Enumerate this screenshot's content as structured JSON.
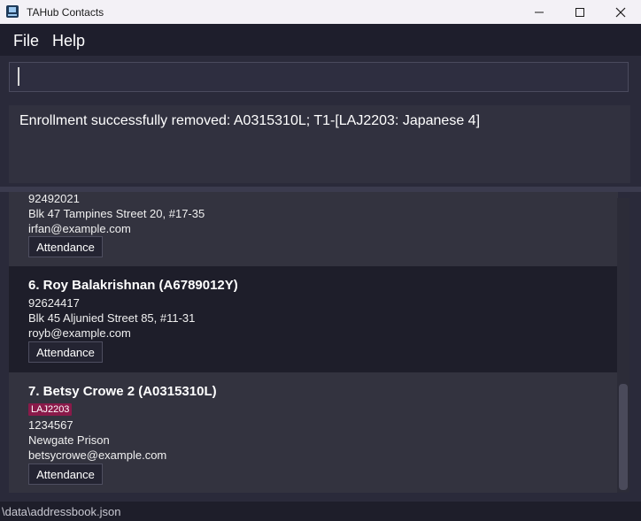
{
  "window": {
    "title": "TAHub Contacts"
  },
  "menu": {
    "file": "File",
    "help": "Help"
  },
  "command": {
    "value": ""
  },
  "result": {
    "message": "Enrollment successfully removed: A0315310L; T1-[LAJ2203: Japanese 4]"
  },
  "persons": [
    {
      "partial_phone": "92492021",
      "address": "Blk 47 Tampines Street 20, #17-35",
      "email": "irfan@example.com",
      "attendance_label": "Attendance"
    },
    {
      "title": "6.  Roy Balakrishnan (A6789012Y)",
      "phone": "92624417",
      "address": "Blk 45 Aljunied Street 85, #11-31",
      "email": "royb@example.com",
      "attendance_label": "Attendance"
    },
    {
      "title": "7.  Betsy Crowe 2 (A0315310L)",
      "tag": "LAJ2203",
      "phone": "1234567",
      "address": "Newgate Prison",
      "email": "betsycrowe@example.com",
      "attendance_label": "Attendance"
    }
  ],
  "status": {
    "path": "\\data\\addressbook.json"
  },
  "colors": {
    "tag": "#8a1a4a",
    "background": "#2a2a3a",
    "card": "#33333f"
  },
  "icons": {
    "app": "app-logo-icon",
    "minimize": "minimize-icon",
    "maximize": "maximize-icon",
    "close": "close-icon"
  }
}
